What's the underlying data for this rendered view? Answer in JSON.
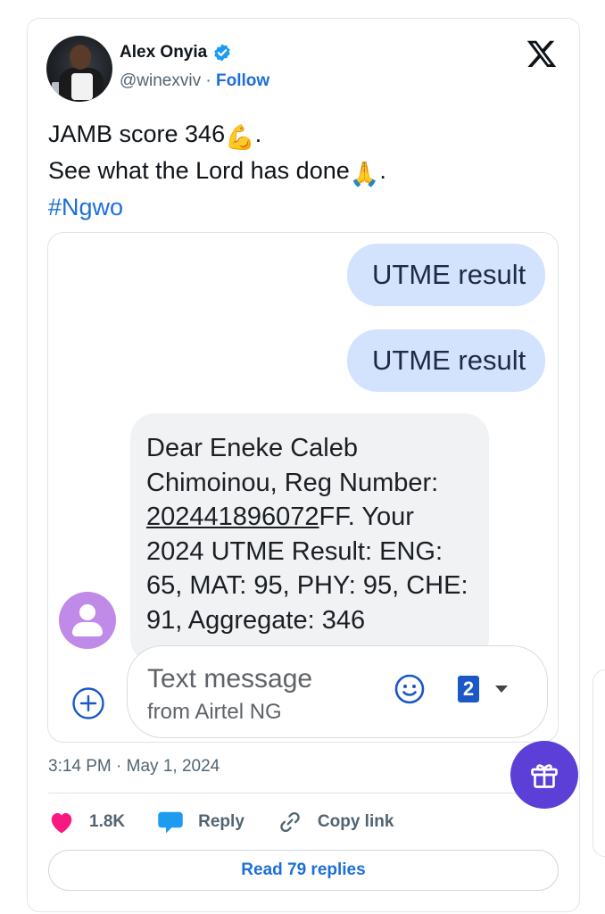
{
  "tweet": {
    "author_name": "Alex Onyia",
    "handle": "@winexviv",
    "separator": " · ",
    "follow_label": "Follow",
    "text_line1": "JAMB score 346",
    "text_line1_emoji": "💪",
    "text_line1_end": ".",
    "text_line2": "See what the Lord has done",
    "text_line2_emoji": "🙏",
    "text_line2_end": ".",
    "hashtag": "#Ngwo",
    "timestamp": "3:14 PM · May 1, 2024",
    "verified": true
  },
  "sms": {
    "outgoing": [
      "UTME result",
      "UTME result"
    ],
    "incoming_before": "Dear Eneke Caleb Chimoinou, Reg Number: ",
    "incoming_reg_number": "202441896072",
    "incoming_after": "FF. Your 2024 UTME Result: ENG: 65, MAT: 95, PHY: 95, CHE: 91, Aggregate: 346",
    "compose_placeholder": "Text message",
    "compose_sub": "from Airtel NG",
    "sim_slot": "2"
  },
  "actions": {
    "likes": "1.8K",
    "reply_label": "Reply",
    "copy_label": "Copy link"
  },
  "read_replies_label": "Read 79 replies",
  "icons": {
    "verified": "verified-badge-icon",
    "x_logo": "x-logo-icon",
    "heart": "heart-icon",
    "reply": "reply-bubble-icon",
    "link": "link-icon",
    "gift": "gift-icon",
    "emoji": "smiley-icon",
    "plus": "plus-circle-icon"
  },
  "colors": {
    "link_blue": "#1d6fd8",
    "heart": "#f91880",
    "sms_out_bubble": "#d3e3fd",
    "sms_in_bubble": "#f0f2f4",
    "fab": "#5b3fd6"
  }
}
